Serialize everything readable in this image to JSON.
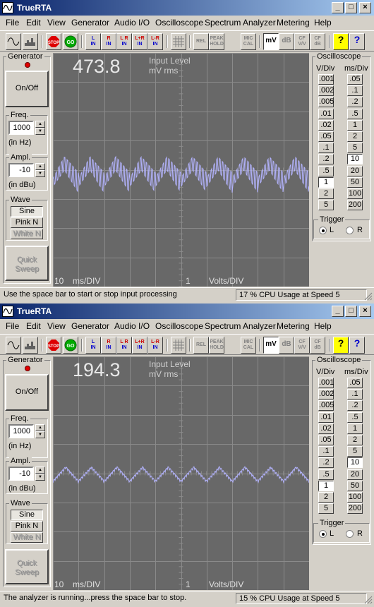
{
  "app": {
    "title": "TrueRTA"
  },
  "titlebar_buttons": [
    "_",
    "□",
    "×"
  ],
  "menu": [
    "File",
    "Edit",
    "View",
    "Generator",
    "Audio I/O",
    "Oscilloscope",
    "Spectrum Analyzer",
    "Metering",
    "Help"
  ],
  "toolbar": {
    "stop": "STOP",
    "go": "GO",
    "l_in": [
      "L",
      "IN"
    ],
    "r_in": [
      "R",
      "IN"
    ],
    "lr_in": [
      "L R",
      "IN"
    ],
    "lplusr_in": [
      "L+R",
      "IN"
    ],
    "lminusr_in": [
      "L-R",
      "IN"
    ],
    "rel": "REL",
    "peak_hold": [
      "PEAK",
      "HOLD"
    ],
    "mic_cal": [
      "MIC",
      "CAL"
    ],
    "mv": "mV",
    "db": "dB",
    "cf_vv": [
      "CF",
      "V/V"
    ],
    "cf_db": [
      "CF",
      "dB"
    ],
    "help_q": "?",
    "whatsthis": "?"
  },
  "generator": {
    "title": "Generator",
    "onoff": "On/Off",
    "freq_label": "Freq.",
    "freq_unit": "(in Hz)",
    "ampl_label": "Ampl.",
    "ampl_unit": "(in dBu)",
    "wave_label": "Wave",
    "waves": [
      "Sine",
      "Pink N",
      "White N"
    ],
    "quick_sweep": [
      "Quick",
      "Sweep"
    ]
  },
  "oscilloscope": {
    "title": "Oscilloscope",
    "vdiv_label": "V/Div",
    "msdiv_label": "ms/Div",
    "vdiv": [
      ".001",
      ".002",
      ".005",
      ".01",
      ".02",
      ".05",
      ".1",
      ".2",
      ".5",
      "1",
      "2",
      "5"
    ],
    "msdiv": [
      ".05",
      ".1",
      ".2",
      ".5",
      "1",
      "2",
      "5",
      "10",
      "20",
      "50",
      "100",
      "200"
    ],
    "trigger_label": "Trigger",
    "trigger_l": "L",
    "trigger_r": "R"
  },
  "screen_labels": {
    "input_level": "Input Level",
    "units": "mV rms",
    "ms_div_value": "10",
    "ms_div_unit": "ms/DIV",
    "volts_div_value": "1",
    "volts_div_unit": "Volts/DIV"
  },
  "windows": [
    {
      "freq_value": "1000",
      "ampl_value": "-10",
      "readout": "473.8",
      "status_left": "Use the space bar to start or stop input processing",
      "status_right": "17 % CPU Usage at Speed 5"
    },
    {
      "freq_value": "1000",
      "ampl_value": "-10",
      "readout": "194.3",
      "status_left": "The analyzer is running...press the space bar to stop.",
      "status_right": "15 % CPU Usage at Speed 5"
    }
  ],
  "colors": {
    "trace": "#b4b4ff",
    "screen_bg": "#686868",
    "grid": "#8a8a8a",
    "title_start": "#0a246a",
    "title_end": "#a6caf0"
  }
}
